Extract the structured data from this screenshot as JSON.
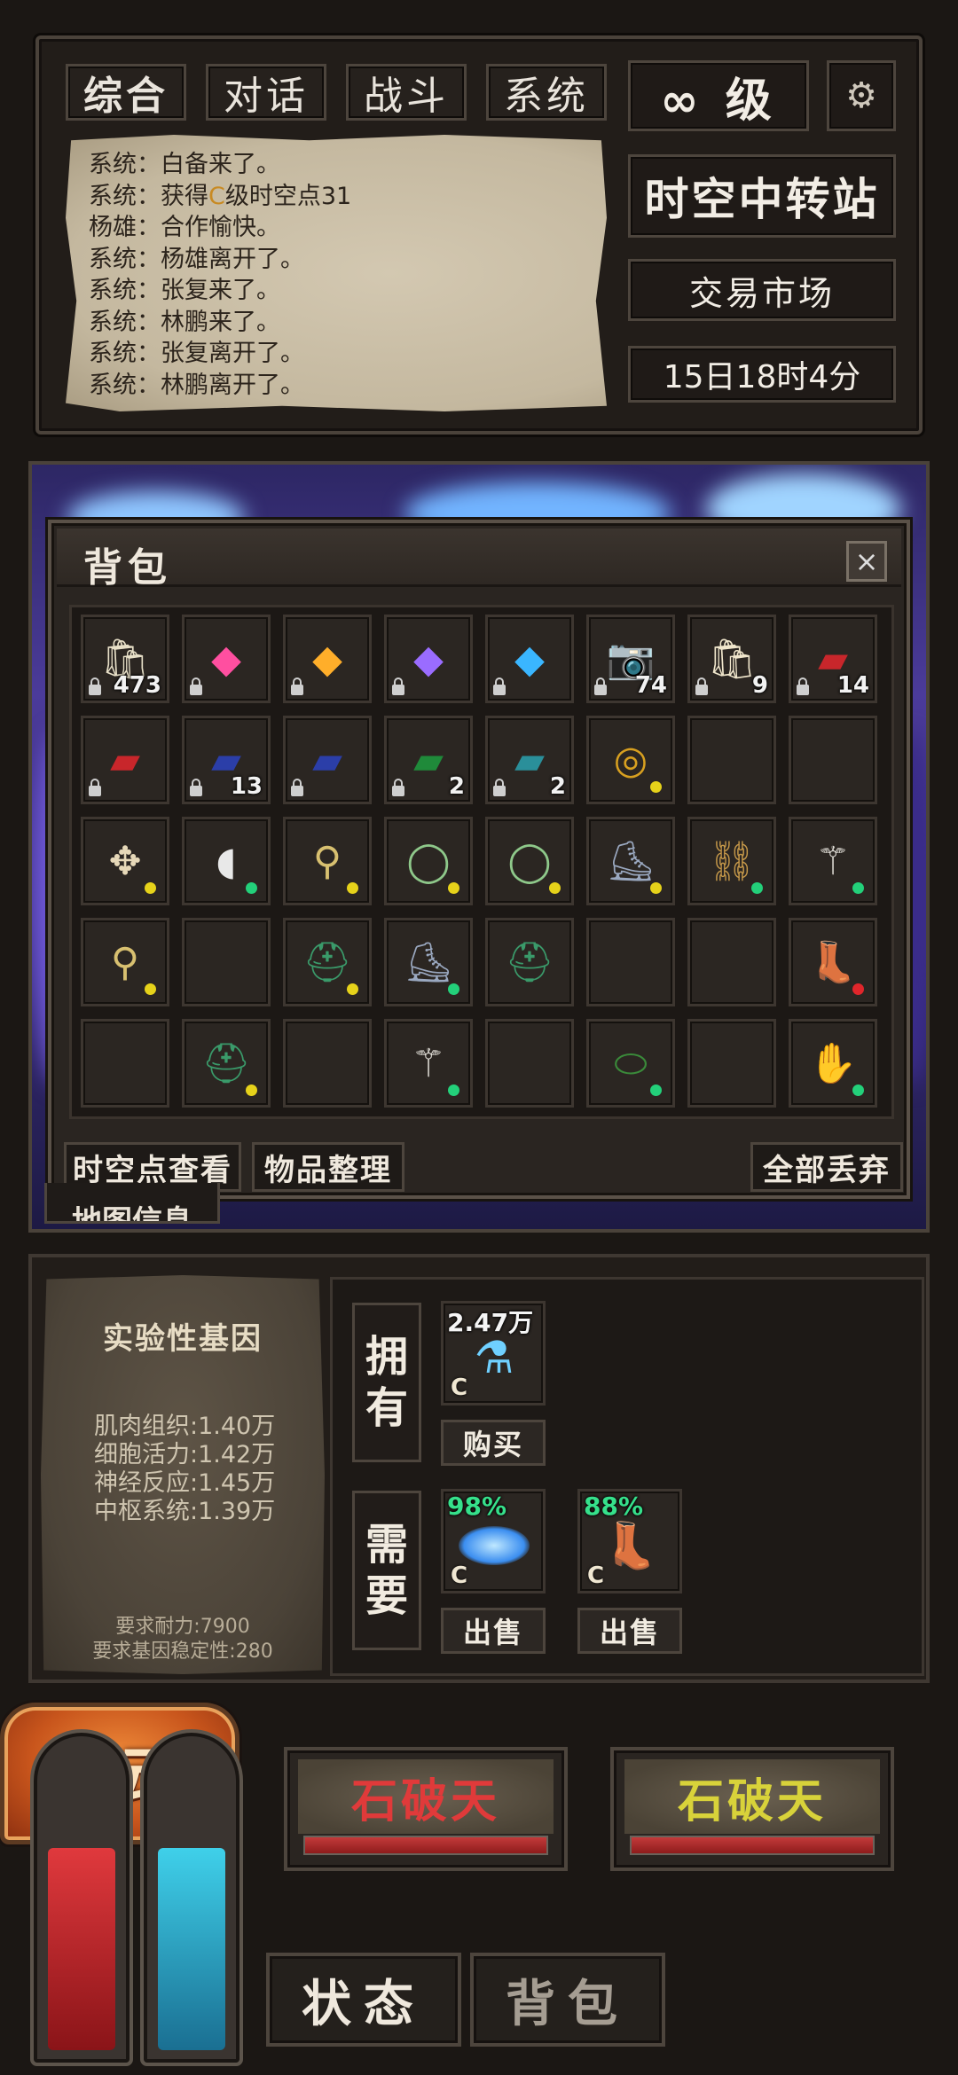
{
  "tabs": [
    "综合",
    "对话",
    "战斗",
    "系统"
  ],
  "level": "∞ 级",
  "gear_icon": "gear-icon",
  "station_button": "时空中转站",
  "market_button": "交易市场",
  "time": "15日18时4分",
  "log": [
    {
      "pre": "系统：白备来了。",
      "hl": "",
      "post": ""
    },
    {
      "pre": "系统：获得",
      "hl": "C",
      "post": "级时空点31"
    },
    {
      "pre": "杨雄：合作愉快。",
      "hl": "",
      "post": ""
    },
    {
      "pre": "系统：杨雄离开了。",
      "hl": "",
      "post": ""
    },
    {
      "pre": "系统：张复来了。",
      "hl": "",
      "post": ""
    },
    {
      "pre": "系统：林鹏来了。",
      "hl": "",
      "post": ""
    },
    {
      "pre": "系统：张复离开了。",
      "hl": "",
      "post": ""
    },
    {
      "pre": "系统：林鹏离开了。",
      "hl": "",
      "post": ""
    }
  ],
  "bag": {
    "title": "背包",
    "close": "×",
    "buttons": {
      "view_points": "时空点查看",
      "sort": "物品整理",
      "drop_all": "全部丢弃"
    },
    "items": [
      {
        "icon": "rice-bag-icon",
        "count": "473",
        "locked": true,
        "dot": ""
      },
      {
        "icon": "pink-gem-icon",
        "count": "",
        "locked": true,
        "dot": ""
      },
      {
        "icon": "orange-gem-icon",
        "count": "",
        "locked": true,
        "dot": ""
      },
      {
        "icon": "purple-gem-icon",
        "count": "",
        "locked": true,
        "dot": ""
      },
      {
        "icon": "blue-gem-icon",
        "count": "",
        "locked": true,
        "dot": ""
      },
      {
        "icon": "camera-icon",
        "count": "74",
        "locked": true,
        "dot": ""
      },
      {
        "icon": "dog-food-bag-icon",
        "count": "9",
        "locked": true,
        "dot": ""
      },
      {
        "icon": "red-book-icon",
        "count": "14",
        "locked": true,
        "dot": ""
      },
      {
        "icon": "red-book-icon",
        "count": "",
        "locked": true,
        "dot": ""
      },
      {
        "icon": "blue-book-icon",
        "count": "13",
        "locked": true,
        "dot": ""
      },
      {
        "icon": "blue-book-icon",
        "count": "",
        "locked": true,
        "dot": ""
      },
      {
        "icon": "green-book-icon",
        "count": "2",
        "locked": true,
        "dot": ""
      },
      {
        "icon": "teal-book-icon",
        "count": "2",
        "locked": true,
        "dot": ""
      },
      {
        "icon": "ring-icon",
        "count": "",
        "locked": false,
        "dot": "yellow"
      },
      {
        "icon": "",
        "count": "",
        "locked": false,
        "dot": ""
      },
      {
        "icon": "",
        "count": "",
        "locked": false,
        "dot": ""
      },
      {
        "icon": "cloth-armor-icon",
        "count": "",
        "locked": false,
        "dot": "yellow"
      },
      {
        "icon": "mouse-icon",
        "count": "",
        "locked": false,
        "dot": "green"
      },
      {
        "icon": "amulet-icon",
        "count": "",
        "locked": false,
        "dot": "yellow"
      },
      {
        "icon": "bead-bracelet-icon",
        "count": "",
        "locked": false,
        "dot": "yellow"
      },
      {
        "icon": "bead-bracelet-icon",
        "count": "",
        "locked": false,
        "dot": "yellow"
      },
      {
        "icon": "boots-icon",
        "count": "",
        "locked": false,
        "dot": "yellow"
      },
      {
        "icon": "chain-necklace-icon",
        "count": "",
        "locked": false,
        "dot": "green"
      },
      {
        "icon": "whisk-icon",
        "count": "",
        "locked": false,
        "dot": "green"
      },
      {
        "icon": "amulet-icon",
        "count": "",
        "locked": false,
        "dot": "yellow"
      },
      {
        "icon": "",
        "count": "",
        "locked": false,
        "dot": ""
      },
      {
        "icon": "helmet-icon",
        "count": "",
        "locked": false,
        "dot": "yellow"
      },
      {
        "icon": "boots-icon",
        "count": "",
        "locked": false,
        "dot": "green"
      },
      {
        "icon": "helmet-icon",
        "count": "",
        "locked": false,
        "dot": ""
      },
      {
        "icon": "",
        "count": "",
        "locked": false,
        "dot": ""
      },
      {
        "icon": "",
        "count": "",
        "locked": false,
        "dot": ""
      },
      {
        "icon": "leather-boots-icon",
        "count": "",
        "locked": false,
        "dot": "red"
      },
      {
        "icon": "",
        "count": "",
        "locked": false,
        "dot": ""
      },
      {
        "icon": "helmet-icon",
        "count": "",
        "locked": false,
        "dot": "yellow"
      },
      {
        "icon": "",
        "count": "",
        "locked": false,
        "dot": ""
      },
      {
        "icon": "whisk-icon",
        "count": "",
        "locked": false,
        "dot": "green"
      },
      {
        "icon": "",
        "count": "",
        "locked": false,
        "dot": ""
      },
      {
        "icon": "green-bracer-icon",
        "count": "",
        "locked": false,
        "dot": "green"
      },
      {
        "icon": "",
        "count": "",
        "locked": false,
        "dot": ""
      },
      {
        "icon": "claw-glove-icon",
        "count": "",
        "locked": false,
        "dot": "green"
      }
    ]
  },
  "map_info_tab": "地图信息",
  "gene": {
    "title": "实验性基因",
    "stats": [
      "肌肉组织:1.40万",
      "细胞活力:1.42万",
      "神经反应:1.45万",
      "中枢系统:1.39万"
    ],
    "requirements": [
      "要求耐力:7900",
      "要求基因稳定性:280"
    ],
    "own_label": "拥有",
    "need_label": "需要",
    "own_item": {
      "icon": "potion-vial-icon",
      "amount": "2.47万",
      "grade": "C",
      "button": "购买"
    },
    "need_items": [
      {
        "icon": "blue-nebula-icon",
        "percent": "98%",
        "grade": "C",
        "button": "出售"
      },
      {
        "icon": "leather-boots-icon",
        "percent": "88%",
        "grade": "C",
        "button": "出售"
      }
    ]
  },
  "enemies": [
    {
      "name": "石破天",
      "name_color": "#e03a3a",
      "hp": 1.0
    },
    {
      "name": "石破天",
      "name_color": "#d8d23a",
      "hp": 1.0
    }
  ],
  "hud": {
    "status": "状态",
    "bag": "背包",
    "action": "行动"
  },
  "colors": {
    "dot_yellow": "#e6d21a",
    "dot_green": "#23d07a",
    "dot_red": "#e0262b"
  }
}
